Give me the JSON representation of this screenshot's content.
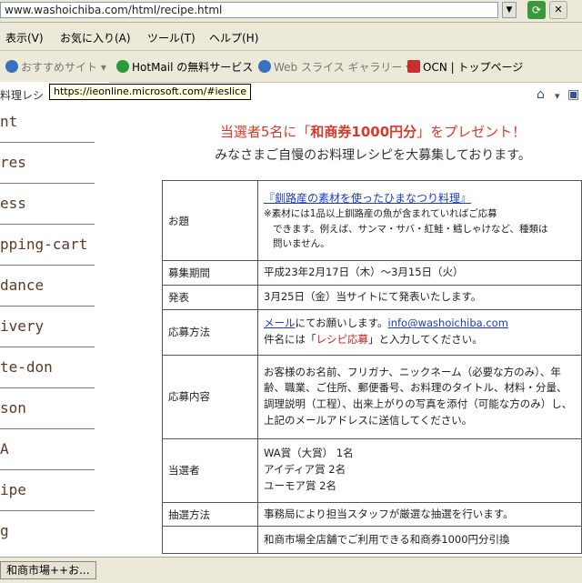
{
  "address": {
    "url": "www.washoichiba.com/html/recipe.html"
  },
  "menu": [
    "表示(V)",
    "お気に入り(A)",
    "ツール(T)",
    "ヘルプ(H)"
  ],
  "links": [
    {
      "label": "おすすめサイト ▾",
      "color": "#3a70c0"
    },
    {
      "label": "HotMail の無料サービス",
      "color": "#2a9a3a"
    },
    {
      "label": "Web スライス ギャラリー ▾",
      "color": "#3a70c0"
    },
    {
      "label": "OCN | トップページ",
      "color": "#c83030"
    }
  ],
  "tooltip": "https://ieonline.microsoft.com/#ieslice",
  "left_tab": "料理レシ",
  "left_items": [
    "nt",
    "res",
    "ess",
    "pping-cart",
    "dance",
    "ivery",
    "te-don",
    "son",
    "A",
    "ipe",
    "g"
  ],
  "headline_pre": "当選者5名に「",
  "headline_bold": "和商券1000円分",
  "headline_post": "」をプレゼント！",
  "subline": "みなさまご自慢のお料理レシピを大募集しております。",
  "table": {
    "theme_label": "お題",
    "theme_title": "『釧路産の素材を使ったひまなつり料理』",
    "theme_note1": "※素材には1品以上釧路産の魚が含まれていればご応募",
    "theme_note2": "できます。例えば、サンマ・サバ・紅鮭・鱈しゃけなど、種類は",
    "theme_note3": "問いません。",
    "period_label": "募集期間",
    "period_value": "平成23年2月17日（木）～3月15日（火）",
    "announce_label": "発表",
    "announce_value": "3月25日（金）当サイトにて発表いたします。",
    "method_label": "応募方法",
    "method_mail": "メール",
    "method_text1": "にてお願いします。",
    "method_email": "info@washoichiba.com",
    "method_text2": "件名には「",
    "method_subject": "レシピ応募",
    "method_text3": "」と入力してください。",
    "content_label": "応募内容",
    "content_value": "お客様のお名前、フリガナ、ニックネーム（必要な方のみ）、年齢、職業、ご住所、郵便番号、お料理のタイトル、材料・分量、調理説明（工程）、出来上がりの写真を添付（可能な方のみ）し、上記のメールアドレスに送信してください。",
    "winners_label": "当選者",
    "winners": [
      "WA賞（大賞）  1名",
      "アイディア賞  2名",
      "ユーモア賞  2名"
    ],
    "lottery_label": "抽選方法",
    "lottery_value": "事務局により担当スタッフが厳選な抽選を行います。",
    "prize_value": "和商市場全店舗でご利用できる和商券1000円分引換"
  },
  "status": {
    "task": "和商市場++お..."
  }
}
